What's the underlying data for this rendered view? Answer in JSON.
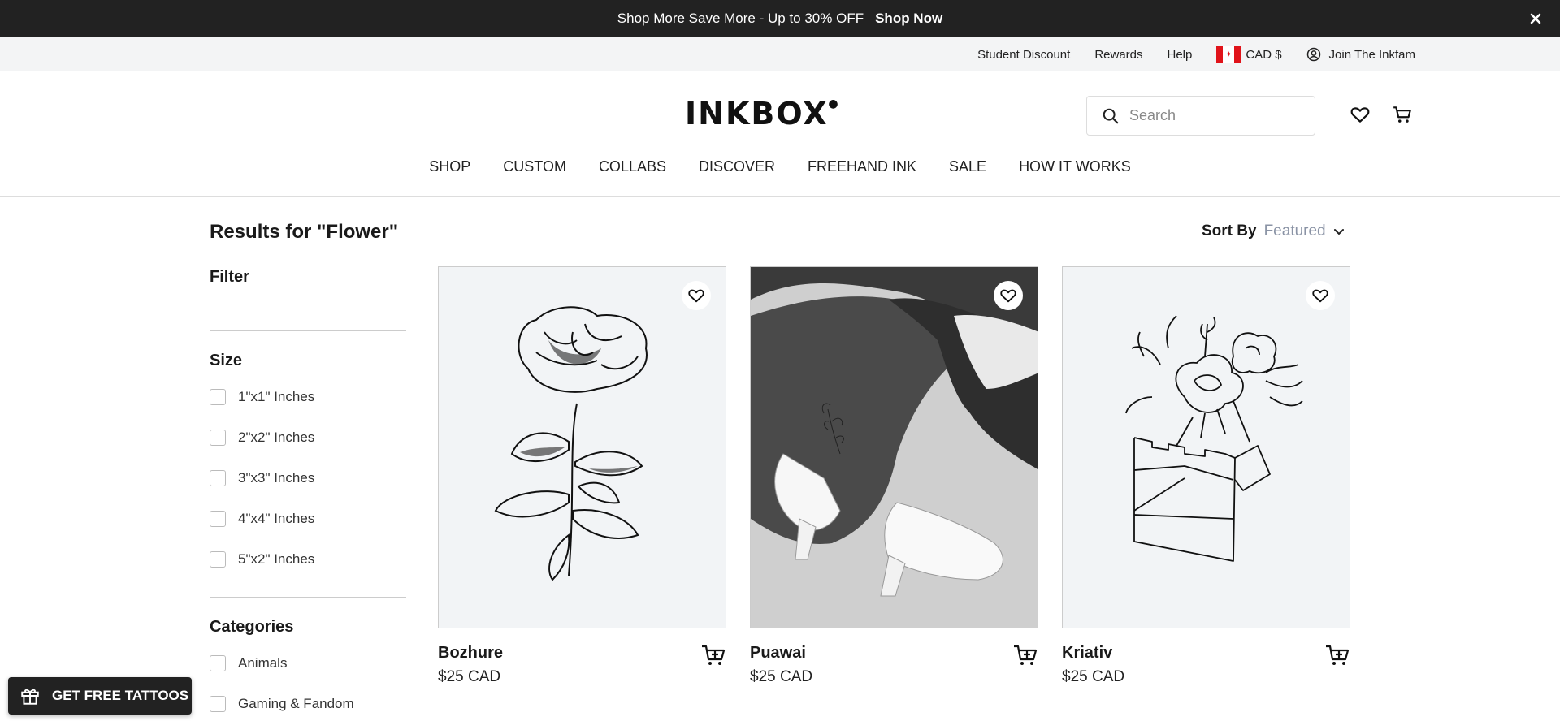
{
  "promo": {
    "text": "Shop More Save More - Up to 30% OFF",
    "link": "Shop Now"
  },
  "utility": {
    "student_discount": "Student Discount",
    "rewards": "Rewards",
    "help": "Help",
    "currency": "CAD $",
    "join": "Join The Inkfam"
  },
  "header": {
    "logo": "INKBOX",
    "search_placeholder": "Search"
  },
  "nav": [
    "SHOP",
    "CUSTOM",
    "COLLABS",
    "DISCOVER",
    "FREEHAND INK",
    "SALE",
    "HOW IT WORKS"
  ],
  "results": {
    "title": "Results for \"Flower\"",
    "sort_label": "Sort By",
    "sort_value": "Featured"
  },
  "filters": {
    "filter_heading": "Filter",
    "size_heading": "Size",
    "sizes": [
      "1\"x1\" Inches",
      "2\"x2\" Inches",
      "3\"x3\" Inches",
      "4\"x4\" Inches",
      "5\"x2\" Inches"
    ],
    "categories_heading": "Categories",
    "categories": [
      "Animals",
      "Gaming & Fandom"
    ]
  },
  "products": [
    {
      "name": "Bozhure",
      "price": "$25 CAD"
    },
    {
      "name": "Puawai",
      "price": "$25 CAD"
    },
    {
      "name": "Kriativ",
      "price": "$25 CAD"
    }
  ],
  "free_tattoos": "GET FREE TATTOOS",
  "colors": {
    "promo_bg": "#222222",
    "utility_bg": "#f3f4f5",
    "sort_value": "#8a93a5",
    "card_bg": "#f2f4f6"
  }
}
